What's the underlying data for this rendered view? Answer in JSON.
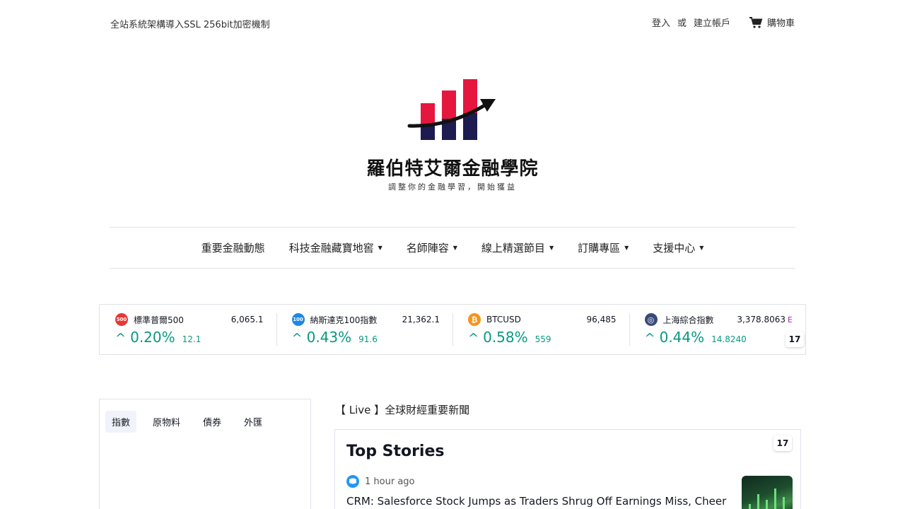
{
  "topbar": {
    "security_notice": "全站系統架構導入SSL 256bit加密機制",
    "login": "登入",
    "or": "或",
    "register": "建立帳戶",
    "cart": "購物車"
  },
  "brand": {
    "name": "羅伯特艾爾金融學院",
    "tagline": "調整你的金融學習，開始獲益",
    "logo_colors": {
      "red": "#e5173f",
      "navy": "#1d1b4f"
    }
  },
  "nav": {
    "items": [
      {
        "label": "重要金融動態",
        "dropdown": false
      },
      {
        "label": "科技金融藏寶地窖",
        "dropdown": true
      },
      {
        "label": "名師陣容",
        "dropdown": true
      },
      {
        "label": "線上精選節目",
        "dropdown": true
      },
      {
        "label": "訂購專區",
        "dropdown": true
      },
      {
        "label": "支援中心",
        "dropdown": true
      }
    ]
  },
  "ticker": {
    "items": [
      {
        "badge": "500",
        "name": "標準普爾500",
        "price": "6,065.1",
        "pct": "0.20%",
        "change": "12.1",
        "icon_color": "#e53935"
      },
      {
        "badge": "100",
        "name": "納斯達克100指數",
        "price": "21,362.1",
        "pct": "0.43%",
        "change": "91.6",
        "icon_color": "#1e88e5"
      },
      {
        "badge": "₿",
        "name": "BTCUSD",
        "price": "96,485",
        "pct": "0.58%",
        "change": "559",
        "icon_color": "#f7931a"
      },
      {
        "badge": "◎",
        "name": "上海綜合指數",
        "price": "3,378.8063",
        "pct": "0.44%",
        "change": "14.8240",
        "icon_color": "#3a4a7a"
      }
    ],
    "arrow": "^",
    "overflow_hint": "E",
    "up_color": "#089981",
    "tv_logo": "17"
  },
  "market_widget": {
    "tabs": [
      "指數",
      "原物料",
      "債券",
      "外匯"
    ],
    "active_tab": "指數"
  },
  "news": {
    "heading": "【 Live 】全球財經重要新聞",
    "title": "Top Stories",
    "tv_logo": "17",
    "story": {
      "time": "1 hour ago",
      "headline": "CRM: Salesforce Stock Jumps as Traders Shrug Off Earnings Miss, Cheer"
    }
  }
}
